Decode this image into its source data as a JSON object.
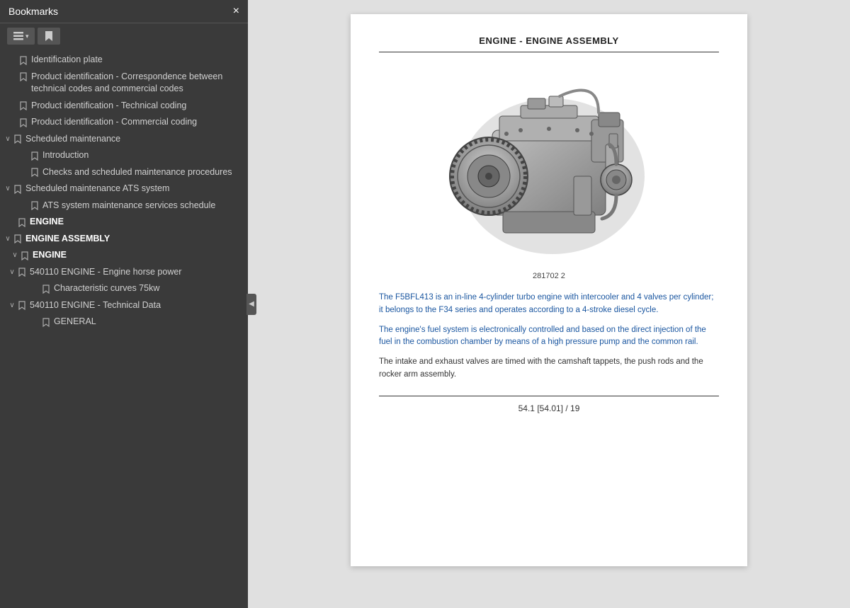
{
  "sidebar": {
    "title": "Bookmarks",
    "close_label": "×",
    "toolbar": {
      "list_icon": "list-icon",
      "bookmark_icon": "bookmark-icon-toolbar",
      "chevron_down": "▾"
    },
    "tree": [
      {
        "id": "item-id-plate",
        "level": 0,
        "indent": 12,
        "hasChevron": false,
        "label": "Identification plate"
      },
      {
        "id": "item-correspondence",
        "level": 0,
        "indent": 12,
        "hasChevron": false,
        "label": "Product identification - Correspondence between technical codes and commercial codes"
      },
      {
        "id": "item-tech-coding",
        "level": 0,
        "indent": 12,
        "hasChevron": false,
        "label": "Product identification - Technical coding"
      },
      {
        "id": "item-comm-coding",
        "level": 0,
        "indent": 12,
        "hasChevron": false,
        "label": "Product identification - Commercial coding"
      },
      {
        "id": "item-sched-maint",
        "level": 0,
        "indent": 4,
        "hasChevron": true,
        "chevron": "∨",
        "label": "Scheduled maintenance"
      },
      {
        "id": "item-intro",
        "level": 1,
        "indent": 28,
        "hasChevron": false,
        "label": "Introduction"
      },
      {
        "id": "item-checks",
        "level": 1,
        "indent": 28,
        "hasChevron": false,
        "label": "Checks and scheduled maintenance procedures"
      },
      {
        "id": "item-sched-ats",
        "level": 0,
        "indent": 4,
        "hasChevron": true,
        "chevron": "∨",
        "label": "Scheduled maintenance ATS system"
      },
      {
        "id": "item-ats-schedule",
        "level": 1,
        "indent": 28,
        "hasChevron": false,
        "label": "ATS system maintenance services schedule"
      },
      {
        "id": "item-engine",
        "level": 0,
        "indent": 10,
        "hasChevron": false,
        "label": "ENGINE",
        "bold": true
      },
      {
        "id": "item-engine-assembly",
        "level": 0,
        "indent": 4,
        "hasChevron": true,
        "chevron": "∨",
        "label": "ENGINE ASSEMBLY",
        "bold": true
      },
      {
        "id": "item-engine-sub",
        "level": 1,
        "indent": 14,
        "hasChevron": true,
        "chevron": "∨",
        "label": "ENGINE",
        "bold": true
      },
      {
        "id": "item-540110-hp",
        "level": 2,
        "indent": 10,
        "hasChevron": true,
        "chevron": "∨",
        "label": "540110    ENGINE - Engine horse power"
      },
      {
        "id": "item-char-curves",
        "level": 3,
        "indent": 44,
        "hasChevron": false,
        "label": "Characteristic curves 75kw"
      },
      {
        "id": "item-540110-td",
        "level": 2,
        "indent": 10,
        "hasChevron": true,
        "chevron": "∨",
        "label": "540110    ENGINE - Technical Data"
      },
      {
        "id": "item-general",
        "level": 3,
        "indent": 44,
        "hasChevron": false,
        "label": "GENERAL"
      }
    ]
  },
  "main": {
    "page_title": "ENGINE - ENGINE ASSEMBLY",
    "image_caption": "281702   2",
    "paragraphs": [
      {
        "id": "para1",
        "blue_part": "The F5BFL413 is an in-line 4-cylinder turbo engine with intercooler and 4 valves per cylinder; it belongs to the F34 series and operates according to a 4-stroke diesel cycle.",
        "rest": ""
      },
      {
        "id": "para2",
        "blue_part": "The engine's fuel system is electronically controlled and based on the direct injection of the fuel in the combustion chamber by means of a high pressure pump and the common rail.",
        "rest": ""
      },
      {
        "id": "para3",
        "blue_part": "",
        "rest": "The intake and exhaust valves are timed with the camshaft tappets, the push rods and the rocker arm assembly."
      }
    ],
    "footer": "54.1 [54.01] / 19"
  }
}
